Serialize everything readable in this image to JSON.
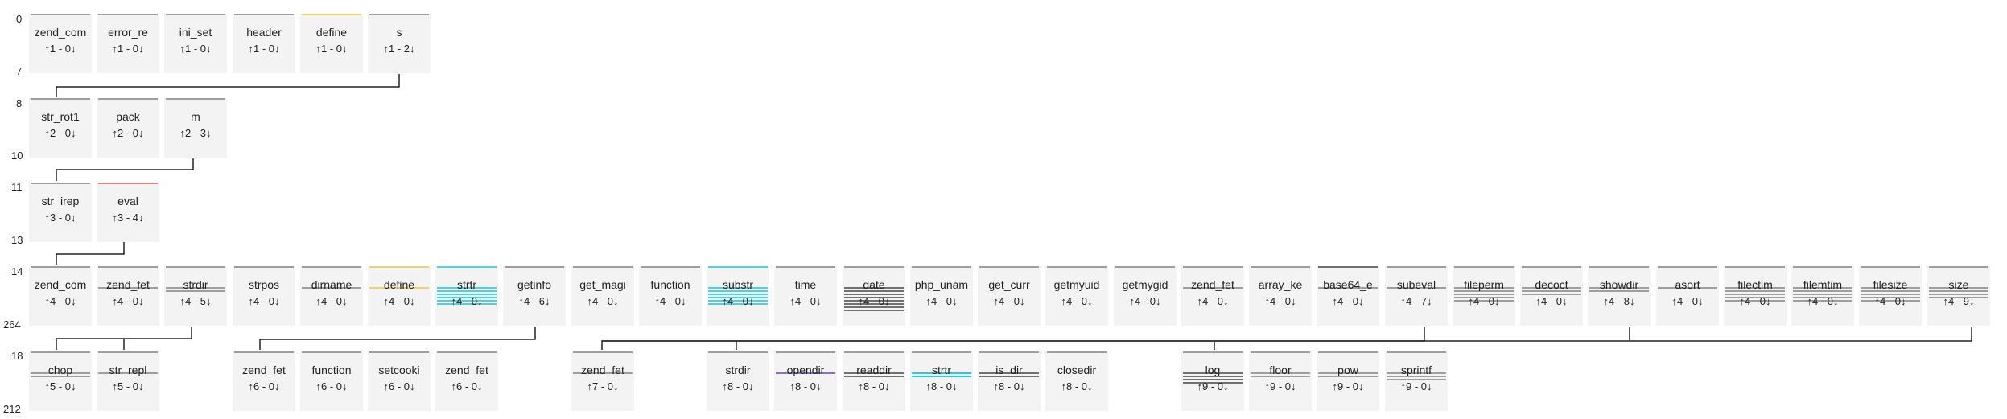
{
  "levels": [
    {
      "top": "0",
      "bottom": "7"
    },
    {
      "top": "8",
      "bottom": "10"
    },
    {
      "top": "11",
      "bottom": "13"
    },
    {
      "top": "14",
      "bottom": "264"
    },
    {
      "top": "18",
      "bottom": "212"
    }
  ],
  "rows": [
    {
      "nodes": [
        {
          "name": "zend_com",
          "count": "↑1 - 0↓",
          "top_color": "#9e9e9e",
          "lines": []
        },
        {
          "name": "error_re",
          "count": "↑1 - 0↓",
          "top_color": "#9e9e9e",
          "lines": []
        },
        {
          "name": "ini_set",
          "count": "↑1 - 0↓",
          "top_color": "#9e9e9e",
          "lines": []
        },
        {
          "name": "header",
          "count": "↑1 - 0↓",
          "top_color": "#9e9e9e",
          "lines": []
        },
        {
          "name": "define",
          "count": "↑1 - 0↓",
          "top_color": "#f0d070",
          "lines": []
        },
        {
          "name": "s",
          "count": "↑1 - 2↓",
          "top_color": "#9e9e9e",
          "lines": []
        }
      ]
    },
    {
      "nodes": [
        {
          "name": "str_rot1",
          "count": "↑2 - 0↓",
          "top_color": "#9e9e9e",
          "lines": []
        },
        {
          "name": "pack",
          "count": "↑2 - 0↓",
          "top_color": "#9e9e9e",
          "lines": []
        },
        {
          "name": "m",
          "count": "↑2 - 3↓",
          "top_color": "#9e9e9e",
          "lines": []
        }
      ]
    },
    {
      "nodes": [
        {
          "name": "str_irep",
          "count": "↑3 - 0↓",
          "top_color": "#9e9e9e",
          "lines": []
        },
        {
          "name": "eval",
          "count": "↑3 - 4↓",
          "top_color": "#f08080",
          "lines": []
        }
      ]
    },
    {
      "nodes": [
        {
          "name": "zend_com",
          "count": "↑4 - 0↓",
          "top_color": "#9e9e9e",
          "lines": []
        },
        {
          "name": "zend_fet",
          "count": "↑4 - 0↓",
          "top_color": "#9e9e9e",
          "lines": [
            "#9e9e9e"
          ]
        },
        {
          "name": "strdir",
          "count": "↑4 - 5↓",
          "top_color": "#9e9e9e",
          "lines": [
            "#9e9e9e",
            "#9e9e9e"
          ]
        },
        {
          "name": "strpos",
          "count": "↑4 - 0↓",
          "top_color": "#9e9e9e",
          "lines": []
        },
        {
          "name": "dirname",
          "count": "↑4 - 0↓",
          "top_color": "#9e9e9e",
          "lines": [
            "#9e9e9e"
          ]
        },
        {
          "name": "define",
          "count": "↑4 - 0↓",
          "top_color": "#f0d070",
          "lines": [
            "#f0d070"
          ]
        },
        {
          "name": "strtr",
          "count": "↑4 - 0↓",
          "top_color": "#4fd0e0",
          "lines": [
            "#4fd0e0",
            "#4fd0e0",
            "#4fd0e0",
            "#4fd0e0",
            "#4fd0e0",
            "#4fd0e0"
          ]
        },
        {
          "name": "getinfo",
          "count": "↑4 - 6↓",
          "top_color": "#9e9e9e",
          "lines": []
        },
        {
          "name": "get_magi",
          "count": "↑4 - 0↓",
          "top_color": "#9e9e9e",
          "lines": []
        },
        {
          "name": "function",
          "count": "↑4 - 0↓",
          "top_color": "#9e9e9e",
          "lines": []
        },
        {
          "name": "substr",
          "count": "↑4 - 0↓",
          "top_color": "#4fd0e0",
          "lines": [
            "#4fd0e0",
            "#4fd0e0",
            "#4fd0e0",
            "#4fd0e0",
            "#4fd0e0",
            "#4fd0e0"
          ]
        },
        {
          "name": "time",
          "count": "↑4 - 0↓",
          "top_color": "#9e9e9e",
          "lines": []
        },
        {
          "name": "date",
          "count": "↑4 - 0↓",
          "top_color": "#9e9e9e",
          "lines": [
            "#707070",
            "#707070",
            "#707070",
            "#707070",
            "#707070",
            "#707070",
            "#707070",
            "#707070"
          ]
        },
        {
          "name": "php_unam",
          "count": "↑4 - 0↓",
          "top_color": "#9e9e9e",
          "lines": []
        },
        {
          "name": "get_curr",
          "count": "↑4 - 0↓",
          "top_color": "#9e9e9e",
          "lines": []
        },
        {
          "name": "getmyuid",
          "count": "↑4 - 0↓",
          "top_color": "#9e9e9e",
          "lines": []
        },
        {
          "name": "getmygid",
          "count": "↑4 - 0↓",
          "top_color": "#9e9e9e",
          "lines": []
        },
        {
          "name": "zend_fet",
          "count": "↑4 - 0↓",
          "top_color": "#9e9e9e",
          "lines": [
            "#9e9e9e"
          ]
        },
        {
          "name": "array_ke",
          "count": "↑4 - 0↓",
          "top_color": "#9e9e9e",
          "lines": []
        },
        {
          "name": "base64_e",
          "count": "↑4 - 0↓",
          "top_color": "#707070",
          "lines": [
            "#9e9e9e"
          ]
        },
        {
          "name": "subeval",
          "count": "↑4 - 7↓",
          "top_color": "#9e9e9e",
          "lines": [
            "#9e9e9e"
          ]
        },
        {
          "name": "fileperm",
          "count": "↑4 - 0↓",
          "top_color": "#9e9e9e",
          "lines": [
            "#9e9e9e",
            "#9e9e9e",
            "#9e9e9e",
            "#9e9e9e",
            "#9e9e9e"
          ]
        },
        {
          "name": "decoct",
          "count": "↑4 - 0↓",
          "top_color": "#9e9e9e",
          "lines": [
            "#9e9e9e",
            "#9e9e9e",
            "#9e9e9e"
          ]
        },
        {
          "name": "showdir",
          "count": "↑4 - 8↓",
          "top_color": "#9e9e9e",
          "lines": [
            "#9e9e9e",
            "#9e9e9e"
          ]
        },
        {
          "name": "asort",
          "count": "↑4 - 0↓",
          "top_color": "#9e9e9e",
          "lines": [
            "#9e9e9e"
          ]
        },
        {
          "name": "filectim",
          "count": "↑4 - 0↓",
          "top_color": "#9e9e9e",
          "lines": [
            "#9e9e9e",
            "#9e9e9e",
            "#9e9e9e",
            "#9e9e9e",
            "#9e9e9e"
          ]
        },
        {
          "name": "filemtim",
          "count": "↑4 - 0↓",
          "top_color": "#9e9e9e",
          "lines": [
            "#9e9e9e",
            "#9e9e9e",
            "#9e9e9e",
            "#9e9e9e",
            "#9e9e9e"
          ]
        },
        {
          "name": "filesize",
          "count": "↑4 - 0↓",
          "top_color": "#9e9e9e",
          "lines": [
            "#9e9e9e",
            "#9e9e9e",
            "#9e9e9e",
            "#9e9e9e",
            "#9e9e9e"
          ]
        },
        {
          "name": "size",
          "count": "↑4 - 9↓",
          "top_color": "#9e9e9e",
          "lines": [
            "#9e9e9e",
            "#9e9e9e",
            "#9e9e9e",
            "#9e9e9e"
          ]
        }
      ]
    },
    {
      "nodes": [
        {
          "name": "chop",
          "count": "↑5 - 0↓",
          "top_color": "#9e9e9e",
          "lines": [
            "#9e9e9e",
            "#9e9e9e"
          ]
        },
        {
          "name": "str_repl",
          "count": "↑5 - 0↓",
          "top_color": "#9e9e9e",
          "lines": [
            "#9e9e9e"
          ]
        },
        {
          "name": "zend_fet",
          "count": "↑6 - 0↓",
          "top_color": "#9e9e9e",
          "lines": []
        },
        {
          "name": "function",
          "count": "↑6 - 0↓",
          "top_color": "#9e9e9e",
          "lines": []
        },
        {
          "name": "setcooki",
          "count": "↑6 - 0↓",
          "top_color": "#9e9e9e",
          "lines": []
        },
        {
          "name": "zend_fet",
          "count": "↑6 - 0↓",
          "top_color": "#9e9e9e",
          "lines": []
        },
        {
          "name": "zend_fet",
          "count": "↑7 - 0↓",
          "top_color": "#9e9e9e",
          "lines": [
            "#9e9e9e"
          ]
        },
        {
          "name": "strdir",
          "count": "↑8 - 0↓",
          "top_color": "#9e9e9e",
          "lines": []
        },
        {
          "name": "opendir",
          "count": "↑8 - 0↓",
          "top_color": "#9e9e9e",
          "lines": [
            "#8a6fd0"
          ]
        },
        {
          "name": "readdir",
          "count": "↑8 - 0↓",
          "top_color": "#9e9e9e",
          "lines": [
            "#707070",
            "#707070"
          ]
        },
        {
          "name": "strtr",
          "count": "↑8 - 0↓",
          "top_color": "#9e9e9e",
          "lines": [
            "#30c8e0",
            "#30c8e0"
          ]
        },
        {
          "name": "is_dir",
          "count": "↑8 - 0↓",
          "top_color": "#9e9e9e",
          "lines": [
            "#707070",
            "#707070"
          ]
        },
        {
          "name": "closedir",
          "count": "↑8 - 0↓",
          "top_color": "#9e9e9e",
          "lines": []
        },
        {
          "name": "log",
          "count": "↑9 - 0↓",
          "top_color": "#9e9e9e",
          "lines": [
            "#707070",
            "#707070",
            "#707070",
            "#707070"
          ]
        },
        {
          "name": "floor",
          "count": "↑9 - 0↓",
          "top_color": "#9e9e9e",
          "lines": [
            "#9e9e9e",
            "#9e9e9e"
          ]
        },
        {
          "name": "pow",
          "count": "↑9 - 0↓",
          "top_color": "#9e9e9e",
          "lines": [
            "#9e9e9e",
            "#9e9e9e"
          ]
        },
        {
          "name": "sprintf",
          "count": "↑9 - 0↓",
          "top_color": "#9e9e9e",
          "lines": [
            "#9e9e9e",
            "#9e9e9e",
            "#9e9e9e"
          ]
        }
      ]
    }
  ]
}
